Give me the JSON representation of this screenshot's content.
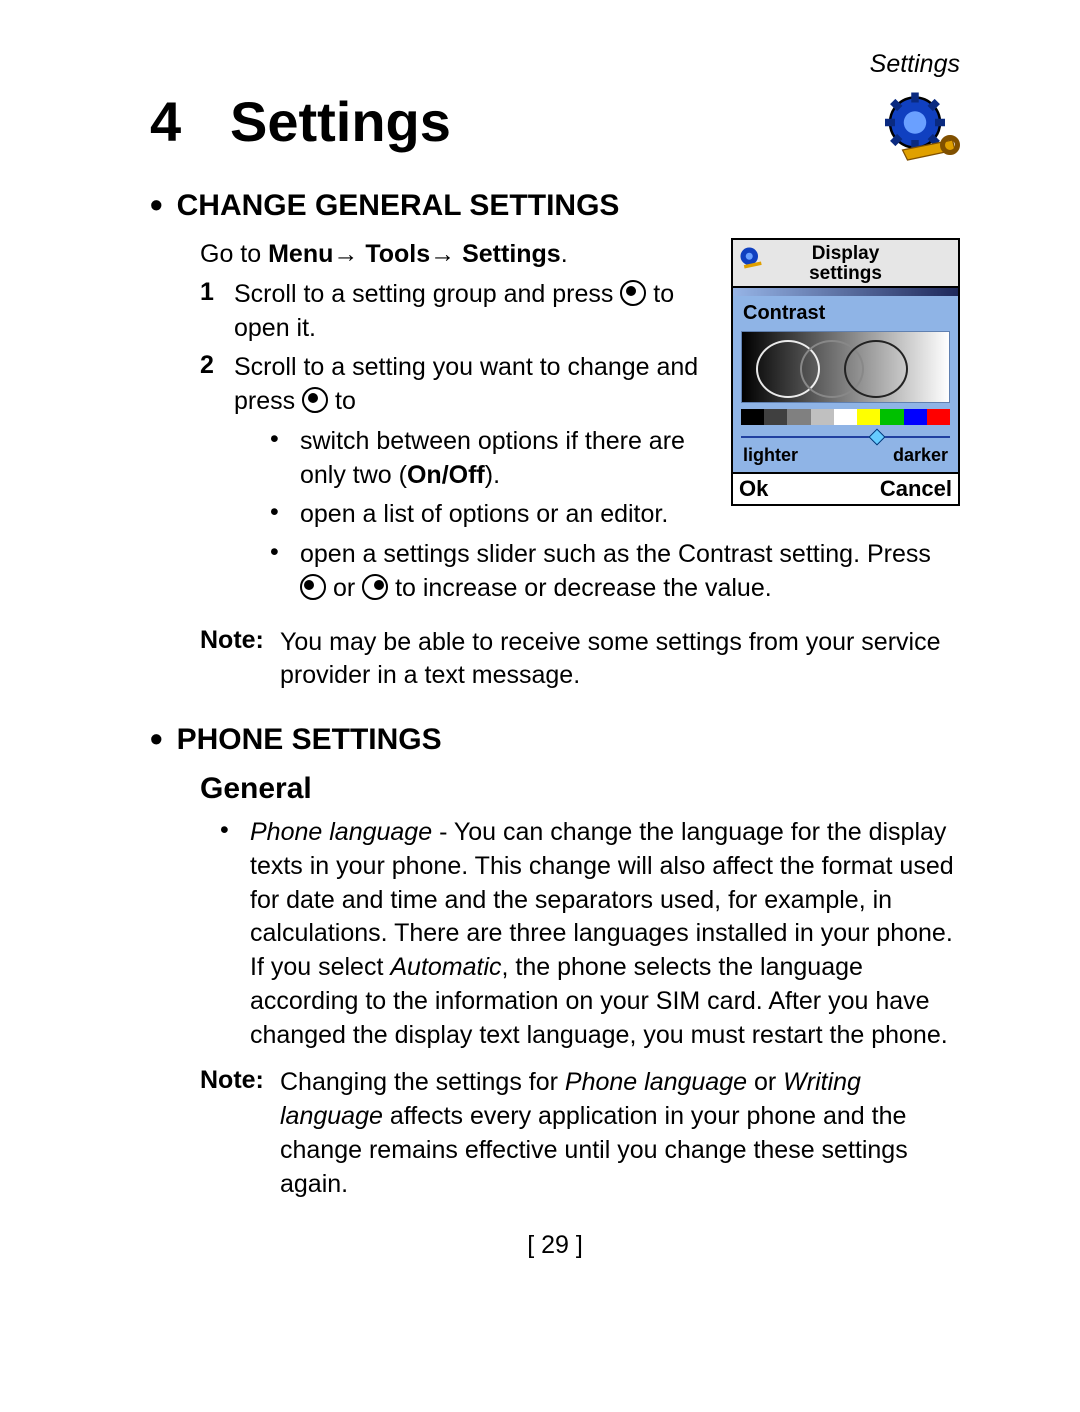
{
  "header": {
    "running_head": "Settings"
  },
  "chapter": {
    "number": "4",
    "title": "Settings"
  },
  "icon_main": "settings-gear-wrench-icon",
  "sections": {
    "change_general": {
      "title": "CHANGE GENERAL SETTINGS",
      "path_prefix": "Go to ",
      "path_menu": "Menu",
      "path_tools": "Tools",
      "path_settings": "Settings",
      "path_suffix": ".",
      "arrow": "→",
      "steps": {
        "s1_a": "Scroll to a setting group and press ",
        "s1_b": " to open it.",
        "s2_a": "Scroll to a setting you want to change and press ",
        "s2_b": " to",
        "b1_a": "switch between options if there are only two (",
        "b1_onoff": "On/Off",
        "b1_b": ").",
        "b2": "open a list of options or an editor.",
        "b3_a": "open a settings slider such as the Contrast setting. Press ",
        "b3_or": " or ",
        "b3_b": " to increase or decrease the value."
      },
      "note_label": "Note:",
      "note_body": "You may be able to receive some settings from your service provider in a text message."
    },
    "phone": {
      "title": "PHONE SETTINGS",
      "general_title": "General",
      "lang_item_name": "Phone language",
      "lang_body_a": " - You can change the language for the display texts in your phone. This change will also affect the format used for date and time and the separators used, for example, in calculations. There are three languages installed in your phone. If you select ",
      "lang_auto": "Automatic",
      "lang_body_b": ", the phone selects the language according to the information on your SIM card. After you have changed the display text language, you must restart the phone.",
      "note_label": "Note:",
      "note_a": "Changing the settings for ",
      "note_pl": "Phone language",
      "note_or": " or ",
      "note_wl": "Writing language",
      "note_b": " affects every application in your phone and the change remains effective until you change these settings again."
    }
  },
  "screenshot": {
    "title_line1": "Display",
    "title_line2": "settings",
    "section_label": "Contrast",
    "lighter": "lighter",
    "darker": "darker",
    "softkey_left": "Ok",
    "softkey_right": "Cancel",
    "colorbar": [
      "#000000",
      "#404040",
      "#808080",
      "#c0c0c0",
      "#ffffff",
      "#ffff00",
      "#00c000",
      "#0000ff",
      "#ff0000"
    ]
  },
  "page_number": "[ 29 ]"
}
